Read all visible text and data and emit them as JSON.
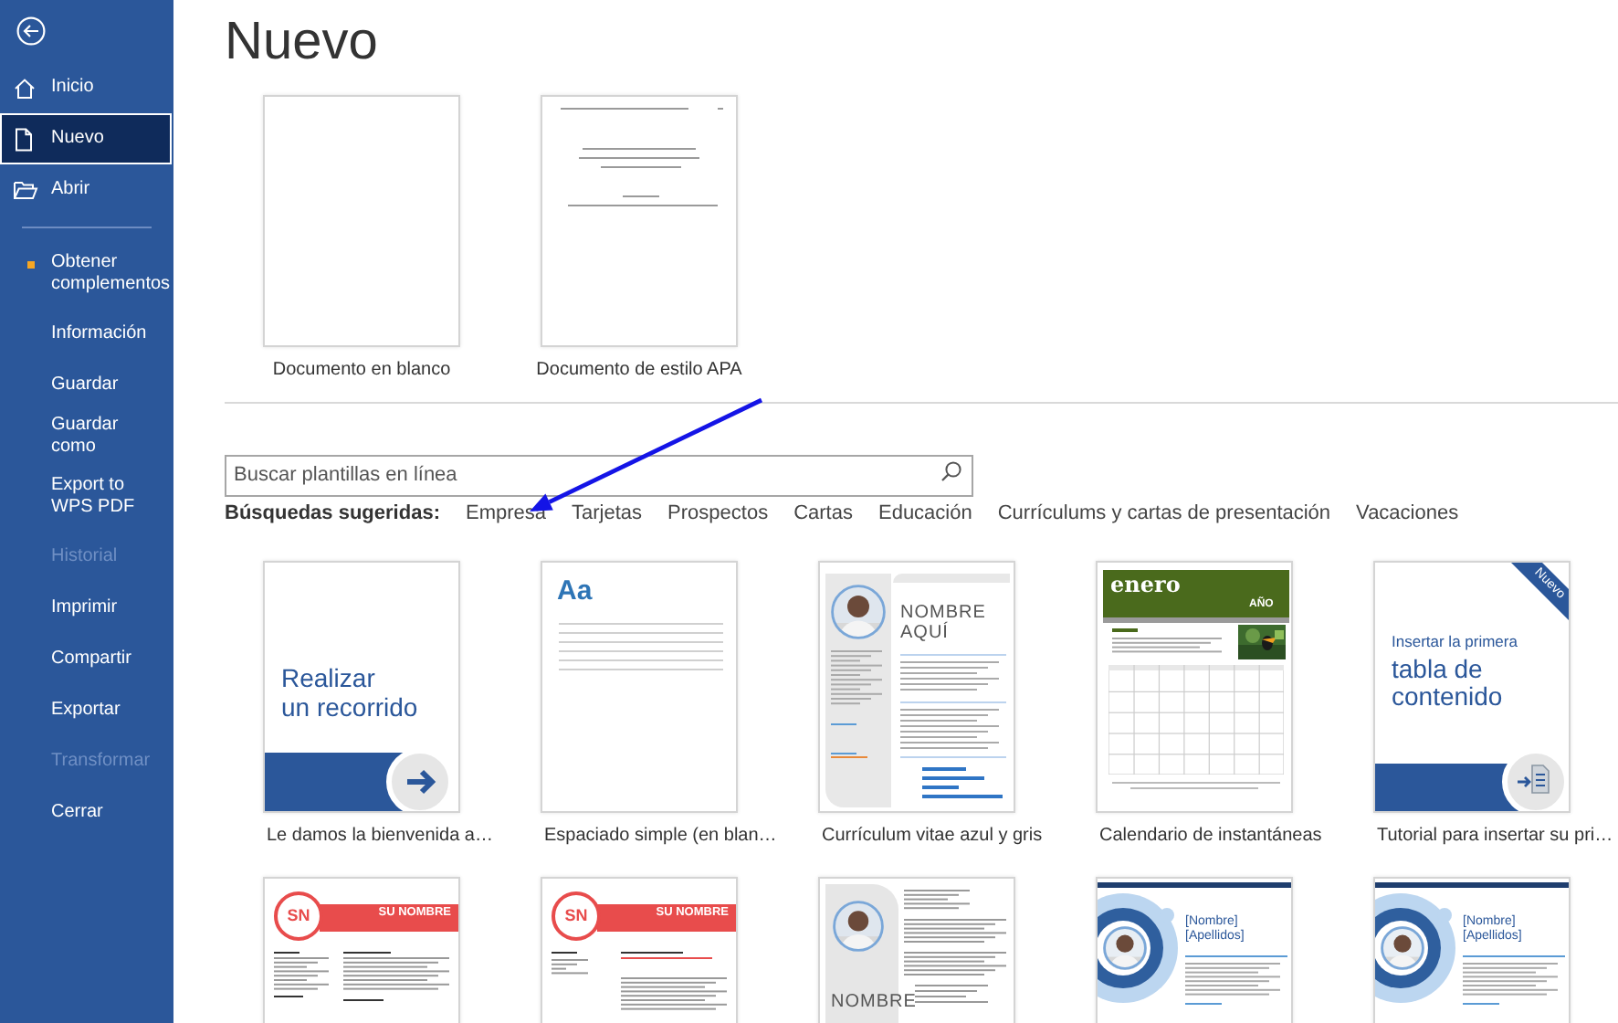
{
  "sidebar": {
    "items": [
      {
        "label": "Inicio",
        "kind": "main",
        "selected": false,
        "disabled": false,
        "notification": false
      },
      {
        "label": "Nuevo",
        "kind": "main",
        "selected": true,
        "disabled": false,
        "notification": false
      },
      {
        "label": "Abrir",
        "kind": "main",
        "selected": false,
        "disabled": false,
        "notification": false
      },
      {
        "label": "Obtener complementos",
        "kind": "plain",
        "selected": false,
        "disabled": false,
        "notification": true
      },
      {
        "label": "Información",
        "kind": "plain",
        "selected": false,
        "disabled": false,
        "notification": false
      },
      {
        "label": "Guardar",
        "kind": "plain",
        "selected": false,
        "disabled": false,
        "notification": false
      },
      {
        "label": "Guardar como",
        "kind": "plain",
        "selected": false,
        "disabled": false,
        "notification": false
      },
      {
        "label": "Export to WPS PDF",
        "kind": "plain",
        "selected": false,
        "disabled": false,
        "notification": false
      },
      {
        "label": "Historial",
        "kind": "plain",
        "selected": false,
        "disabled": true,
        "notification": false
      },
      {
        "label": "Imprimir",
        "kind": "plain",
        "selected": false,
        "disabled": false,
        "notification": false
      },
      {
        "label": "Compartir",
        "kind": "plain",
        "selected": false,
        "disabled": false,
        "notification": false
      },
      {
        "label": "Exportar",
        "kind": "plain",
        "selected": false,
        "disabled": false,
        "notification": false
      },
      {
        "label": "Transformar",
        "kind": "plain",
        "selected": false,
        "disabled": true,
        "notification": false
      },
      {
        "label": "Cerrar",
        "kind": "plain",
        "selected": false,
        "disabled": false,
        "notification": false
      }
    ]
  },
  "title": "Nuevo",
  "featured": [
    {
      "kind": "blank",
      "label": "Documento en blanco"
    },
    {
      "kind": "apa",
      "label": "Documento de estilo APA"
    }
  ],
  "search": {
    "placeholder": "Buscar plantillas en línea"
  },
  "suggestions": {
    "label": "Búsquedas sugeridas:",
    "links": [
      "Empresa",
      "Tarjetas",
      "Prospectos",
      "Cartas",
      "Educación",
      "Currículums y cartas de presentación",
      "Vacaciones"
    ]
  },
  "templates": [
    {
      "kind": "tour",
      "label": "Le damos la bienvenida a…",
      "heading": [
        "Realizar",
        "un recorrido"
      ]
    },
    {
      "kind": "blank-lines",
      "label": "Espaciado simple (en blan…",
      "heading": [
        "Aa"
      ]
    },
    {
      "kind": "resume-photo",
      "label": "Currículum vitae azul y gris",
      "heading": [
        "NOMBRE",
        "AQUÍ"
      ]
    },
    {
      "kind": "calendar",
      "label": "Calendario de instantáneas",
      "heading": [
        "enero",
        "AÑO"
      ]
    },
    {
      "kind": "toc",
      "label": "Tutorial para insertar su pri…",
      "badge": "Nuevo",
      "heading": [
        "Insertar la primera",
        "tabla de",
        "contenido"
      ]
    },
    {
      "kind": "sn-resume",
      "heading": [
        "SN",
        "SU NOMBRE"
      ]
    },
    {
      "kind": "sn-letter",
      "heading": [
        "SN",
        "SU NOMBRE"
      ]
    },
    {
      "kind": "letter-photo",
      "heading": [
        "NOMBRE"
      ]
    },
    {
      "kind": "circle-resume",
      "heading": [
        "[Nombre]",
        "[Apellidos]"
      ]
    },
    {
      "kind": "circle-resume",
      "heading": [
        "[Nombre]",
        "[Apellidos]"
      ]
    }
  ]
}
